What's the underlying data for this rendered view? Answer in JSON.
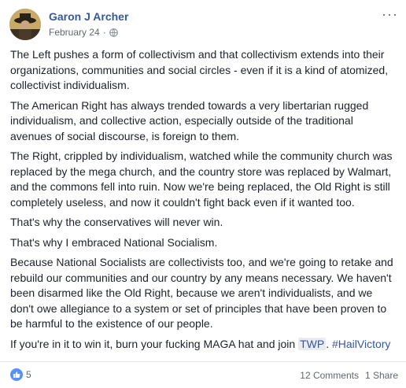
{
  "post": {
    "author": "Garon J Archer",
    "date": "February 24",
    "dot": "·",
    "menu": "···",
    "paragraphs": [
      "The Left pushes a form of collectivism and that collectivism extends into their organizations, communities and social circles - even if it is a kind of atomized, collectivist individualism.",
      "The American Right has always trended towards a very libertarian rugged individualism, and collective action, especially outside of the traditional avenues of social discourse, is foreign to them.",
      "The Right, crippled by individualism, watched while the community church was replaced by the mega church, and the country store was replaced by Walmart, and the commons fell into ruin. Now we're being replaced, the Old Right is still completely useless, and now it couldn't fight back even if it wanted too.",
      "That's why the conservatives will never win.",
      "That's why I embraced National Socialism.",
      "Because National Socialists are collectivists too, and we're going to retake and rebuild our communities and our country by any means necessary. We haven't been disarmed like the Old Right, because we aren't individualists, and we don't owe allegiance to a system or set of principles that have been proven to be harmful to the existence of our people."
    ],
    "last_line_prefix": "If you're in it to win it, burn your fucking MAGA hat and join ",
    "twp": "TWP",
    "last_line_mid": ". ",
    "hashtag": "#HailVictory",
    "reactions_count": "5",
    "comments": "12 Comments",
    "shares": "1 Share"
  },
  "colors": {
    "link": "#365899",
    "like": "#5890ff"
  },
  "icons": [
    "globe-icon",
    "like-icon",
    "more-icon"
  ]
}
